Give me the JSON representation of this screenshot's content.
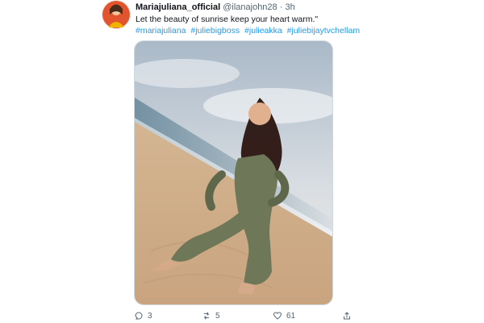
{
  "tweet": {
    "display_name": "Mariajuliana_official",
    "handle": "@ilanajohn28",
    "separator": "·",
    "time": "3h",
    "text": "Let the beauty of sunrise keep your heart warm.\"",
    "hashtags": [
      "#mariajuliana",
      "#juliebigboss",
      "#julieakka",
      "#juliebijaytvchellam"
    ],
    "media_description": "",
    "actions": {
      "reply_icon": "reply-icon",
      "reply_count": "3",
      "retweet_icon": "retweet-icon",
      "retweet_count": "5",
      "like_icon": "like-icon",
      "like_count": "61",
      "share_icon": "share-icon"
    }
  },
  "colors": {
    "text_primary": "#0f1419",
    "text_secondary": "#536471",
    "link": "#1d9bf0",
    "border": "#cfd9de"
  }
}
